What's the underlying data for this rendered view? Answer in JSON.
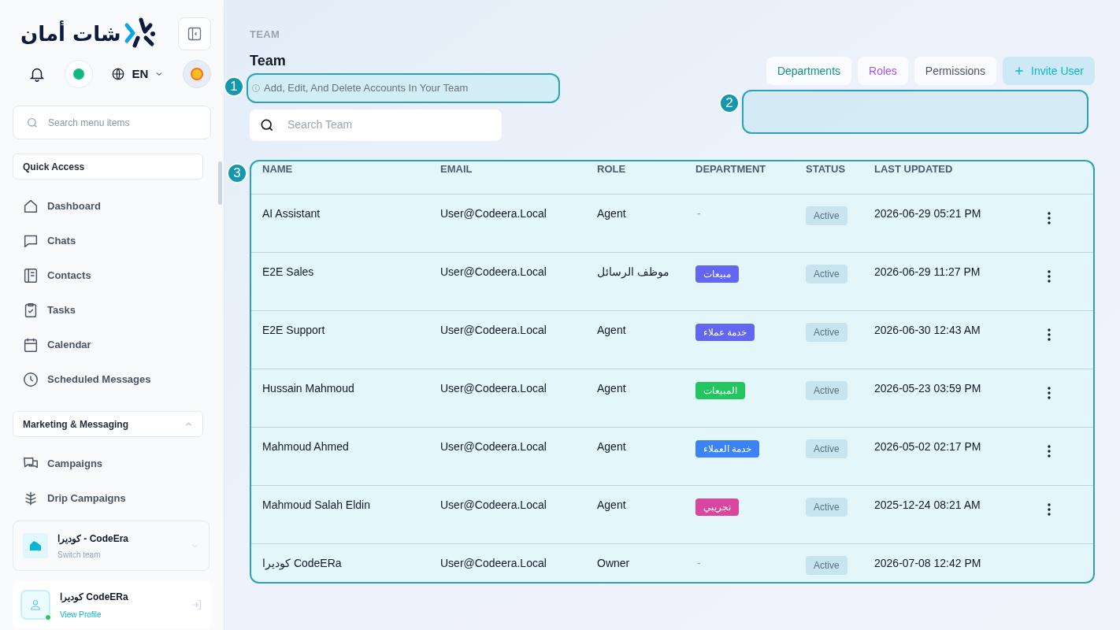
{
  "sidebar": {
    "logo_text": "شات أمان",
    "language": "EN",
    "online": true,
    "search": {
      "placeholder": "Search menu items"
    },
    "sections": [
      {
        "title": "Quick Access",
        "kind": "label",
        "items": [
          {
            "label": "Dashboard"
          },
          {
            "label": "Chats"
          },
          {
            "label": "Contacts"
          },
          {
            "label": "Tasks"
          },
          {
            "label": "Calendar"
          },
          {
            "label": "Scheduled Messages"
          }
        ]
      },
      {
        "title": "Marketing & Messaging",
        "kind": "collapsible",
        "expanded": true,
        "items": [
          {
            "label": "Campaigns"
          },
          {
            "label": "Drip Campaigns"
          }
        ]
      }
    ],
    "team": {
      "name": "كوديرا - CodeEra",
      "subtitle": "Switch team"
    },
    "profile": {
      "name": "كوديرا CodeERa",
      "link": "View Profile",
      "online": true
    }
  },
  "page": {
    "breadcrumb": "TEAM",
    "title": "Team",
    "subtitle": "Add, Edit, And Delete Accounts In Your Team",
    "search": {
      "placeholder": "Search Team"
    },
    "buttons": [
      {
        "label": "Departments",
        "kind": "tab",
        "color": "#0d9488"
      },
      {
        "label": "Roles",
        "kind": "tab",
        "color": "#a855f7"
      },
      {
        "label": "Permissions",
        "kind": "tab",
        "color": "#4b5563"
      },
      {
        "label": "Invite User",
        "kind": "primary",
        "color": "#06b6d4"
      }
    ]
  },
  "table": {
    "columns": [
      "NAME",
      "EMAIL",
      "ROLE",
      "DEPARTMENT",
      "STATUS",
      "LAST UPDATED"
    ],
    "rows": [
      {
        "name": "AI Assistant",
        "email": "User@Codeera.Local",
        "role": "Agent",
        "department": "-",
        "status": "Active",
        "updated": "2026-06-29 05:21 PM",
        "actions": true
      },
      {
        "name": "E2E Sales",
        "email": "User@Codeera.Local",
        "role": "موظف الرسائل",
        "department": {
          "label": "مبيعات",
          "color": "#6366f1"
        },
        "status": "Active",
        "updated": "2026-06-29 11:27 PM",
        "actions": true
      },
      {
        "name": "E2E Support",
        "email": "User@Codeera.Local",
        "role": "Agent",
        "department": {
          "label": "خدمة عملاء",
          "color": "#6366f1"
        },
        "status": "Active",
        "updated": "2026-06-30 12:43 AM",
        "actions": true
      },
      {
        "name": "Hussain Mahmoud",
        "email": "User@Codeera.Local",
        "role": "Agent",
        "department": {
          "label": "المبيعات",
          "color": "#22c55e"
        },
        "status": "Active",
        "updated": "2026-05-23 03:59 PM",
        "actions": true
      },
      {
        "name": "Mahmoud Ahmed",
        "email": "User@Codeera.Local",
        "role": "Agent",
        "department": {
          "label": "خدمة العملاء",
          "color": "#3b82f6"
        },
        "status": "Active",
        "updated": "2026-05-02 02:17 PM",
        "actions": true
      },
      {
        "name": "Mahmoud Salah Eldin",
        "email": "User@Codeera.Local",
        "role": "Agent",
        "department": {
          "label": "تجريبي",
          "color": "#d946a0"
        },
        "status": "Active",
        "updated": "2025-12-24 08:21 AM",
        "actions": true
      },
      {
        "name": "كوديرا CodeERa",
        "email": "User@Codeera.Local",
        "role": "Owner",
        "department": "-",
        "status": "Active",
        "updated": "2026-07-08 12:42 PM",
        "actions": false
      }
    ]
  },
  "annotations": [
    {
      "number": "1"
    },
    {
      "number": "2"
    },
    {
      "number": "3"
    }
  ]
}
